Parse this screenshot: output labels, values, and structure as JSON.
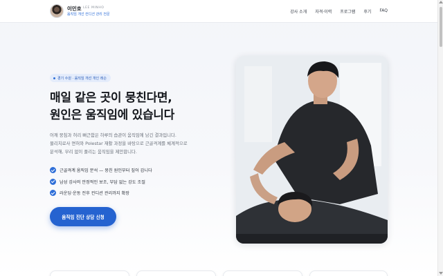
{
  "header": {
    "name": "이민호",
    "name_en": "LEE MINHO",
    "subtitle": "움직임 개선 컨디션 관리 전문",
    "nav": [
      "강사 소개",
      "자격·이력",
      "프로그램",
      "후기",
      "FAQ"
    ]
  },
  "hero": {
    "badge": "경기 수원 · 움직임 개선 개인 레슨",
    "headline": [
      "매일 같은 곳이 뭉친다면,",
      "원인은 움직임에 있습니다"
    ],
    "description": [
      "어깨 뭉침과 허리 뻐근함은 하루의 습관이 움직임에 남긴 결과입니다.",
      "물리치료사 면허와 Polestar 재활 과정을 바탕으로 근골격계를 체계적으로",
      "분석해, 무리 없이 풀리는 움직임을 제안합니다."
    ],
    "checks": [
      "근골격계 움직임 분석 — 뭉친 원인부터 짚어 갑니다",
      "남성 강사의 안정적인 보조, 부담 없는 강도 조절",
      "라운딩·운동 전후 컨디션 관리까지 확장"
    ],
    "cta": "움직임 진단 상담 신청"
  },
  "colors": {
    "accent": "#2563d0",
    "badge_bg": "#e4ecfb"
  },
  "icons": {
    "check": "check-circle-icon"
  }
}
